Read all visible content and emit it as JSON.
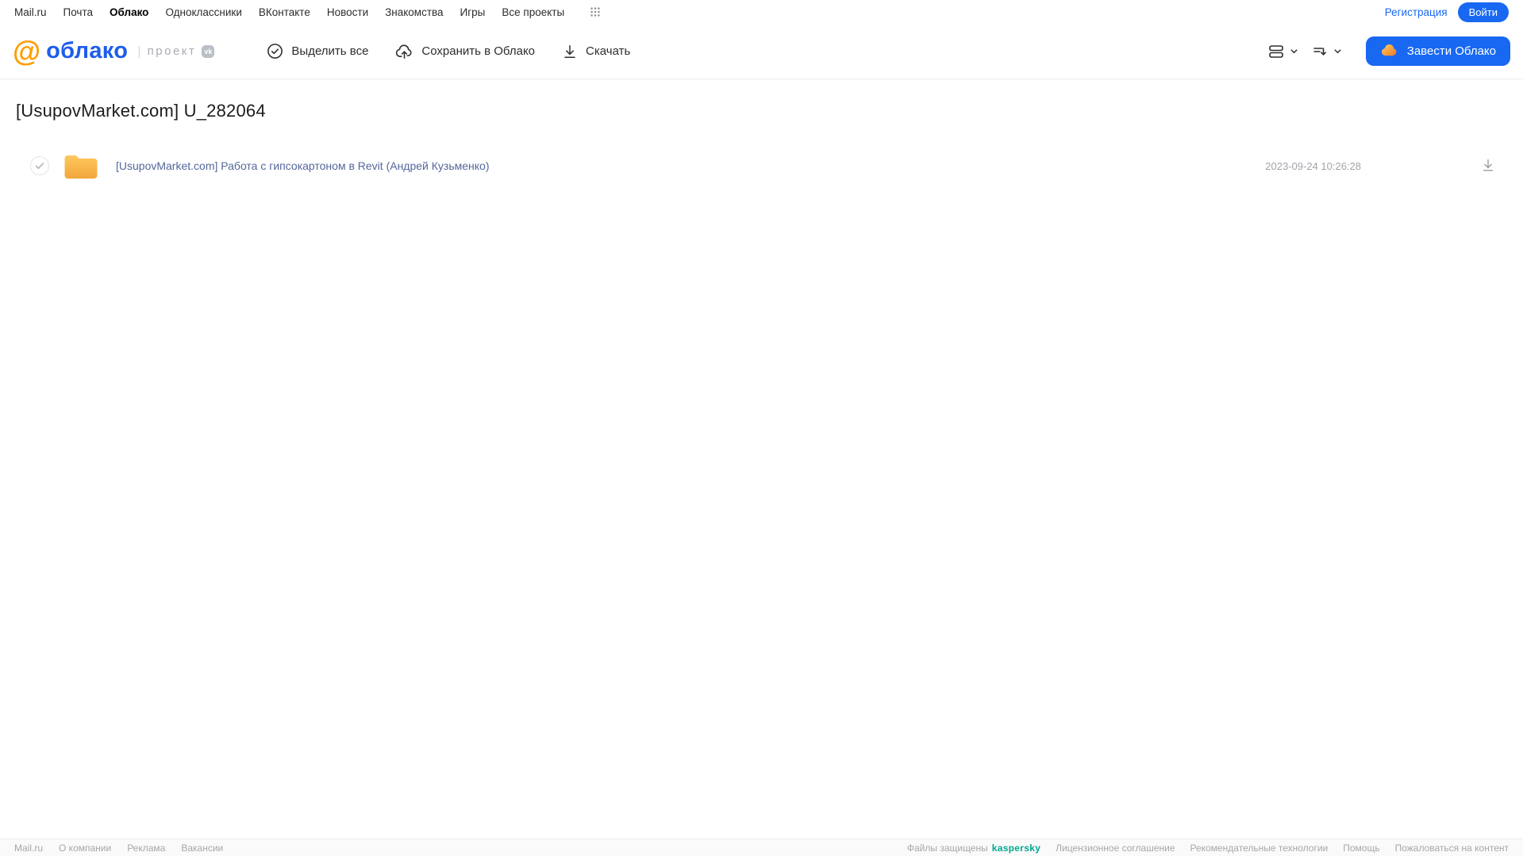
{
  "topbar": {
    "links": [
      "Mail.ru",
      "Почта",
      "Облако",
      "Одноклассники",
      "ВКонтакте",
      "Новости",
      "Знакомства",
      "Игры",
      "Все проекты"
    ],
    "registration_label": "Регистрация",
    "login_label": "Войти"
  },
  "toolbar": {
    "logo_at": "@",
    "logo_text": "облако",
    "divider": "|",
    "project_label": "проект",
    "vk_badge": "vk",
    "select_all_label": "Выделить все",
    "save_to_cloud_label": "Сохранить в Облако",
    "download_label": "Скачать",
    "create_cloud_label": "Завести Облако"
  },
  "main": {
    "title": "[UsupovMarket.com] U_282064",
    "files": [
      {
        "name": "[UsupovMarket.com] Работа с гипсокартоном в Revit (Андрей Кузьменко)",
        "modified": "2023-09-24 10:26:28"
      }
    ]
  },
  "footer": {
    "links": [
      "Mail.ru",
      "О компании",
      "Реклама",
      "Вакансии"
    ],
    "protected_label": "Файлы защищены",
    "kaspersky_label": "kaspersky",
    "legal_links": [
      "Лицензионное соглашение",
      "Рекомендательные технологии",
      "Помощь",
      "Пожаловаться на контент"
    ]
  },
  "colors": {
    "accent_blue": "#1868f2",
    "logo_blue": "#1d5deb",
    "logo_orange": "#ff9e00",
    "folder_yellow_top": "#ffc95e",
    "folder_yellow_bottom": "#f2a53b",
    "kaspersky_green": "#00a88e",
    "link_muted_blue": "#54679a",
    "text_gray": "#a5a7ab"
  }
}
